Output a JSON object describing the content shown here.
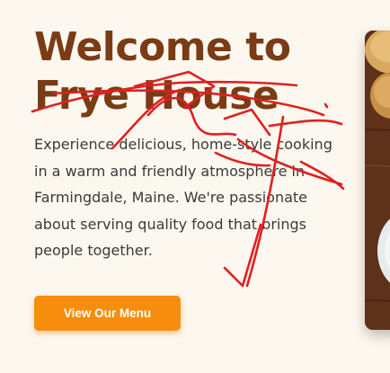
{
  "hero": {
    "title_line1": "Welcome to",
    "title_line2": "Frye House",
    "description": "Experience delicious, home-style cooking in a warm and friendly atmosphere in Farmingdale, Maine. We're passionate about serving quality food that brings people together.",
    "cta_label": "View Our Menu"
  },
  "colors": {
    "background": "#fdf8ef",
    "title": "#7a3b15",
    "body_text": "#3a3a3a",
    "cta_bg": "#f78d0c",
    "cta_text": "#ffffff",
    "scribble": "#e02020"
  },
  "icons": {
    "hero_image": "food-photo"
  }
}
